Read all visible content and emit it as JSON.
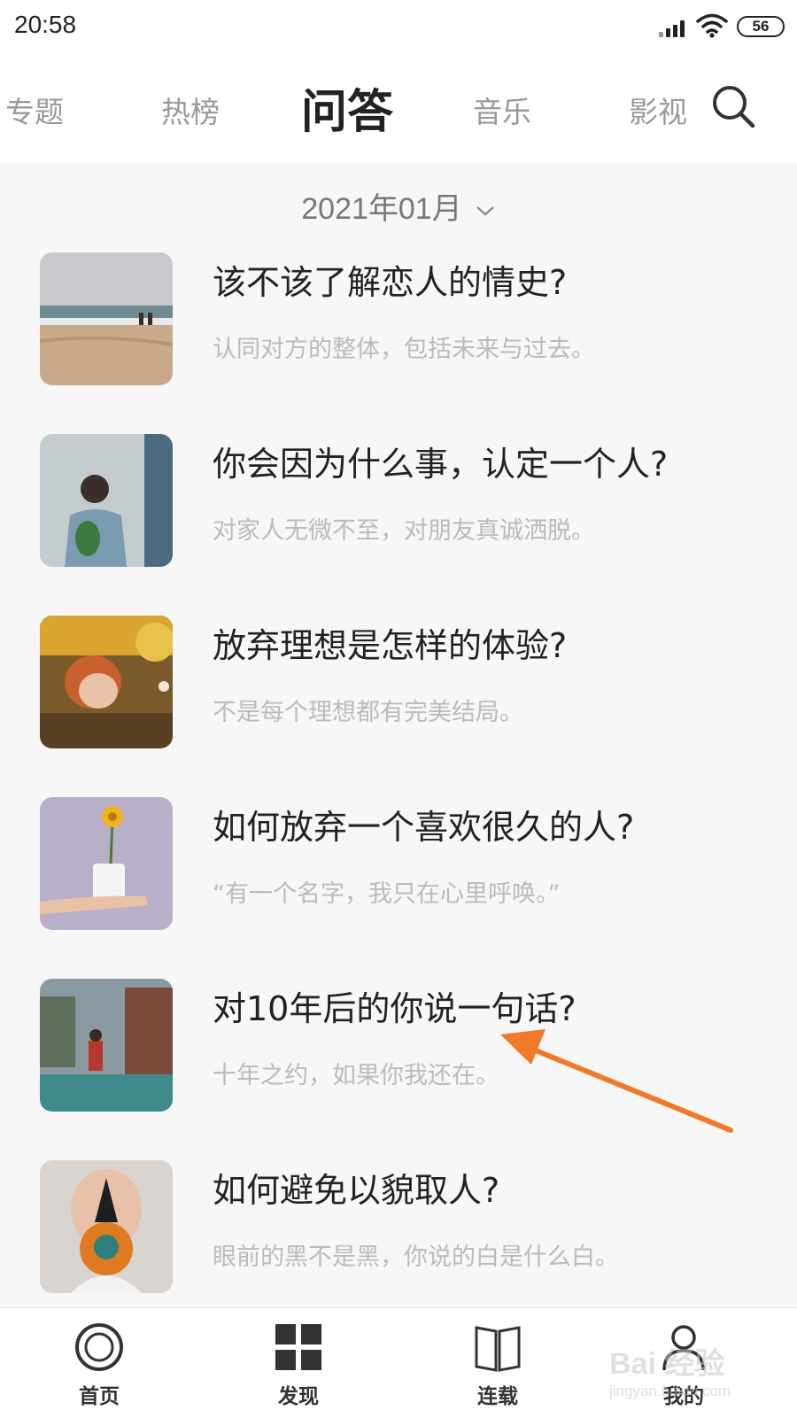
{
  "status_bar": {
    "time": "20:58",
    "battery": "56"
  },
  "top_tabs": [
    {
      "label": "专题",
      "active": false
    },
    {
      "label": "热榜",
      "active": false
    },
    {
      "label": "问答",
      "active": true
    },
    {
      "label": "音乐",
      "active": false
    },
    {
      "label": "影视",
      "active": false
    }
  ],
  "date_selector": {
    "label": "2021年01月"
  },
  "items": [
    {
      "title": "该不该了解恋人的情史?",
      "subtitle": "认同对方的整体，包括未来与过去。",
      "thumbnail": "beach-horse-riders"
    },
    {
      "title": "你会因为什么事，认定一个人?",
      "subtitle": "对家人无微不至，对朋友真诚洒脱。",
      "thumbnail": "woman-with-bouquet"
    },
    {
      "title": "放弃理想是怎样的体验?",
      "subtitle": "不是每个理想都有完美结局。",
      "thumbnail": "woman-lying-in-autumn"
    },
    {
      "title": "如何放弃一个喜欢很久的人?",
      "subtitle": "“有一个名字，我只在心里呼唤。”",
      "thumbnail": "hand-holding-flower-cup"
    },
    {
      "title": "对10年后的你说一句话?",
      "subtitle": "十年之约，如果你我还在。",
      "thumbnail": "street-runner"
    },
    {
      "title": "如何避免以貌取人?",
      "subtitle": "眼前的黑不是黑，你说的白是什么白。",
      "thumbnail": "child-with-pumpkin"
    }
  ],
  "bottom_nav": [
    {
      "label": "首页",
      "icon": "circle-home-icon"
    },
    {
      "label": "发现",
      "icon": "grid-discover-icon"
    },
    {
      "label": "连载",
      "icon": "book-serial-icon"
    },
    {
      "label": "我的",
      "icon": "person-profile-icon"
    }
  ],
  "watermark": {
    "line1": "Bai 经验",
    "line2": "jingyan.baidu.com"
  },
  "colors": {
    "accent_arrow": "#f07a2a",
    "title": "#222222",
    "subtitle": "#bbbbbb",
    "inactive_tab": "#999999"
  }
}
